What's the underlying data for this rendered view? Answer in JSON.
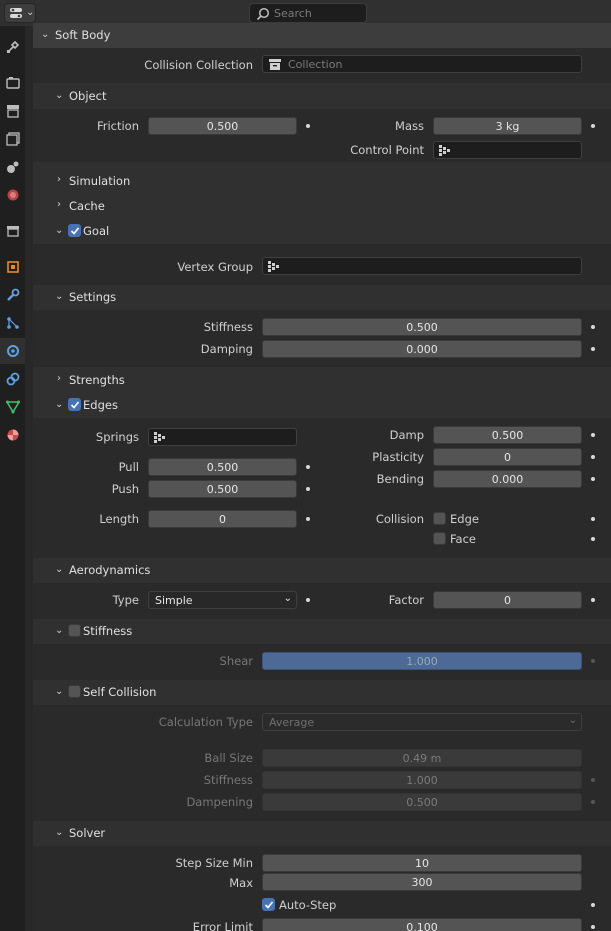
{
  "header": {
    "search_placeholder": "Search"
  },
  "tabs": [
    {
      "name": "tool-icon"
    },
    {
      "name": "render-icon"
    },
    {
      "name": "output-icon"
    },
    {
      "name": "view-layer-icon"
    },
    {
      "name": "scene-icon"
    },
    {
      "name": "world-icon"
    },
    {
      "name": "collection-icon"
    },
    {
      "name": "object-icon"
    },
    {
      "name": "modifier-icon"
    },
    {
      "name": "particles-icon"
    },
    {
      "name": "physics-icon"
    },
    {
      "name": "constraints-icon"
    },
    {
      "name": "data-icon"
    },
    {
      "name": "material-icon"
    }
  ],
  "soft_body": {
    "title": "Soft Body",
    "collision_collection_label": "Collision Collection",
    "collision_collection_placeholder": "Collection",
    "object": {
      "title": "Object",
      "friction_label": "Friction",
      "friction_value": "0.500",
      "mass_label": "Mass",
      "mass_value": "3 kg",
      "control_point_label": "Control Point"
    },
    "simulation_title": "Simulation",
    "cache_title": "Cache",
    "goal": {
      "title": "Goal",
      "enabled": true,
      "vertex_group_label": "Vertex Group",
      "settings": {
        "title": "Settings",
        "stiffness_label": "Stiffness",
        "stiffness_value": "0.500",
        "damping_label": "Damping",
        "damping_value": "0.000"
      },
      "strengths_title": "Strengths"
    },
    "edges": {
      "title": "Edges",
      "enabled": true,
      "springs_label": "Springs",
      "pull_label": "Pull",
      "pull_value": "0.500",
      "push_label": "Push",
      "push_value": "0.500",
      "length_label": "Length",
      "length_value": "0",
      "damp_label": "Damp",
      "damp_value": "0.500",
      "plasticity_label": "Plasticity",
      "plasticity_value": "0",
      "bending_label": "Bending",
      "bending_value": "0.000",
      "collision_label": "Collision",
      "edge_label": "Edge",
      "face_label": "Face",
      "aerodynamics": {
        "title": "Aerodynamics",
        "type_label": "Type",
        "type_value": "Simple",
        "factor_label": "Factor",
        "factor_value": "0"
      },
      "stiffness": {
        "title": "Stiffness",
        "enabled": false,
        "shear_label": "Shear",
        "shear_value": "1.000"
      }
    },
    "self_collision": {
      "title": "Self Collision",
      "enabled": false,
      "calc_type_label": "Calculation Type",
      "calc_type_value": "Average",
      "ball_size_label": "Ball Size",
      "ball_size_value": "0.49 m",
      "stiffness_label": "Stiffness",
      "stiffness_value": "1.000",
      "dampening_label": "Dampening",
      "dampening_value": "0.500"
    },
    "solver": {
      "title": "Solver",
      "step_min_label": "Step Size Min",
      "step_min_value": "10",
      "max_label": "Max",
      "max_value": "300",
      "auto_step_label": "Auto-Step",
      "auto_step_enabled": true,
      "error_limit_label": "Error Limit",
      "error_limit_value": "0.100"
    }
  }
}
